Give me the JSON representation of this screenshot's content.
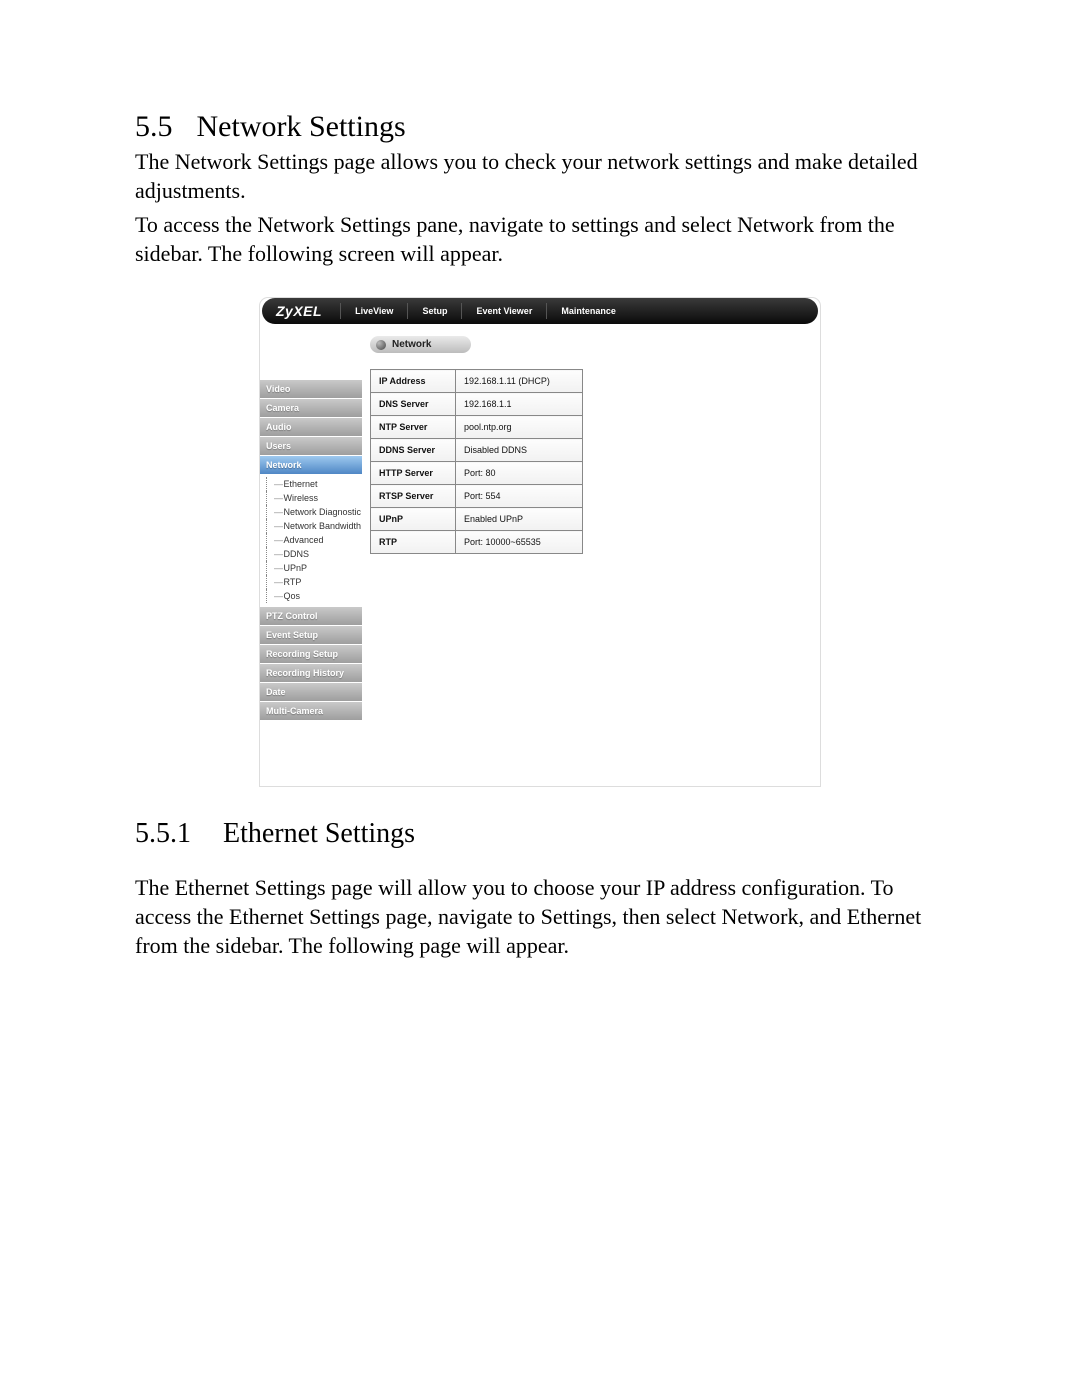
{
  "doc": {
    "section_num": "5.5",
    "section_title": "Network Settings",
    "para1": "The Network Settings page allows you to check your network settings and make detailed adjustments.",
    "para2": "To access the Network Settings pane, navigate to settings and select Network from the sidebar. The following screen will appear.",
    "sub_num": "5.5.1",
    "sub_title": "Ethernet Settings",
    "sub_para": "The Ethernet Settings page will allow you to choose your IP address configuration. To access the Ethernet Settings page, navigate to Settings, then select Network, and Ethernet from the sidebar. The following page will appear."
  },
  "ui": {
    "brand": "ZyXEL",
    "tabs": [
      "LiveView",
      "Setup",
      "Event Viewer",
      "Maintenance"
    ],
    "crumb": "Network",
    "sidebar": {
      "items": [
        "Video",
        "Camera",
        "Audio",
        "Users",
        "Network",
        "PTZ Control",
        "Event Setup",
        "Recording Setup",
        "Recording History",
        "Date",
        "Multi-Camera"
      ],
      "active": "Network",
      "network_sub": [
        "Ethernet",
        "Wireless",
        "Network Diagnostic",
        "Network Bandwidth",
        "Advanced",
        "DDNS",
        "UPnP",
        "RTP",
        "Qos"
      ]
    },
    "table": [
      {
        "k": "IP Address",
        "v": "192.168.1.11  (DHCP)"
      },
      {
        "k": "DNS Server",
        "v": "192.168.1.1"
      },
      {
        "k": "NTP Server",
        "v": "pool.ntp.org"
      },
      {
        "k": "DDNS Server",
        "v": "Disabled DDNS"
      },
      {
        "k": "HTTP Server",
        "v": "Port: 80"
      },
      {
        "k": "RTSP Server",
        "v": "Port: 554"
      },
      {
        "k": "UPnP",
        "v": "Enabled UPnP"
      },
      {
        "k": "RTP",
        "v": "Port: 10000~65535"
      }
    ]
  }
}
